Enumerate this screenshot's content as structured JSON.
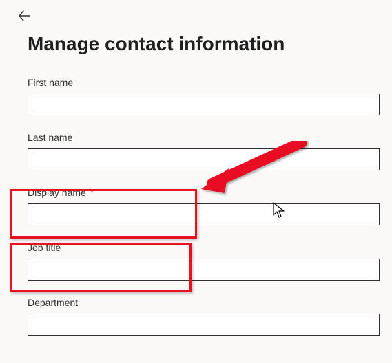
{
  "header": {
    "title": "Manage contact information"
  },
  "fields": {
    "first_name": {
      "label": "First name",
      "value": ""
    },
    "last_name": {
      "label": "Last name",
      "value": ""
    },
    "display_name": {
      "label": "Display name",
      "required_mark": "*",
      "value": ""
    },
    "job_title": {
      "label": "Job title",
      "value": ""
    },
    "department": {
      "label": "Department",
      "value": ""
    }
  },
  "annotation": {
    "highlight_color": "#e81123",
    "arrow_color": "#e81123"
  }
}
